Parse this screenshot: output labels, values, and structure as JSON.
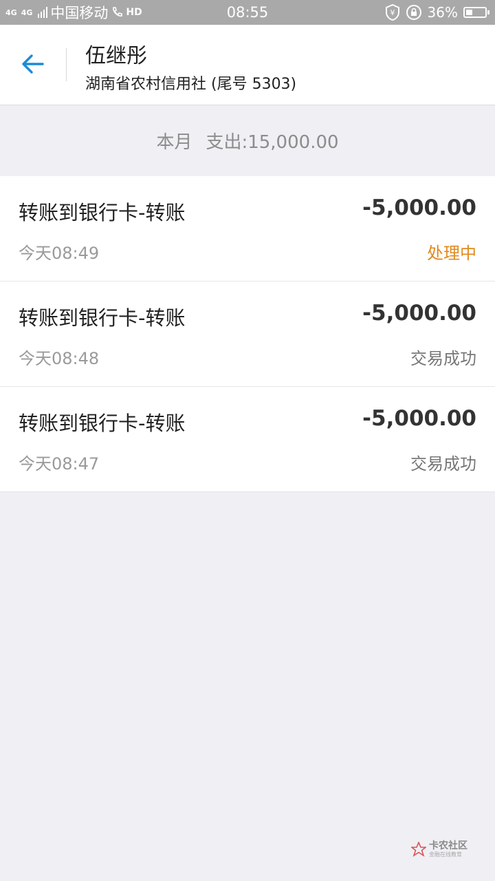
{
  "status_bar": {
    "network_1": "4G",
    "network_2": "4G",
    "carrier": "中国移动",
    "hd_label": "HD",
    "time": "08:55",
    "battery_percent": "36%",
    "battery_level": 0.36,
    "icons": [
      "signal-icon",
      "phone-hd-icon",
      "yen-shield-icon",
      "rotation-lock-icon",
      "battery-icon"
    ]
  },
  "header": {
    "back_icon": "arrow-left-icon",
    "account_name": "伍继彤",
    "bank": "湖南省农村信用社 (尾号 5303)"
  },
  "summary": {
    "period": "本月",
    "expense": "支出:15,000.00"
  },
  "transactions": [
    {
      "title": "转账到银行卡-转账",
      "amount": "-5,000.00",
      "time": "今天08:49",
      "status": "处理中",
      "status_color": "#e08a1e"
    },
    {
      "title": "转账到银行卡-转账",
      "amount": "-5,000.00",
      "time": "今天08:48",
      "status": "交易成功",
      "status_color": "#777777"
    },
    {
      "title": "转账到银行卡-转账",
      "amount": "-5,000.00",
      "time": "今天08:47",
      "status": "交易成功",
      "status_color": "#777777"
    }
  ],
  "watermark": {
    "main": "卡农社区",
    "sub": "金融在线教育"
  },
  "colors": {
    "accent": "#1a8bd8",
    "pending": "#e08a1e",
    "background": "#efeff4"
  }
}
